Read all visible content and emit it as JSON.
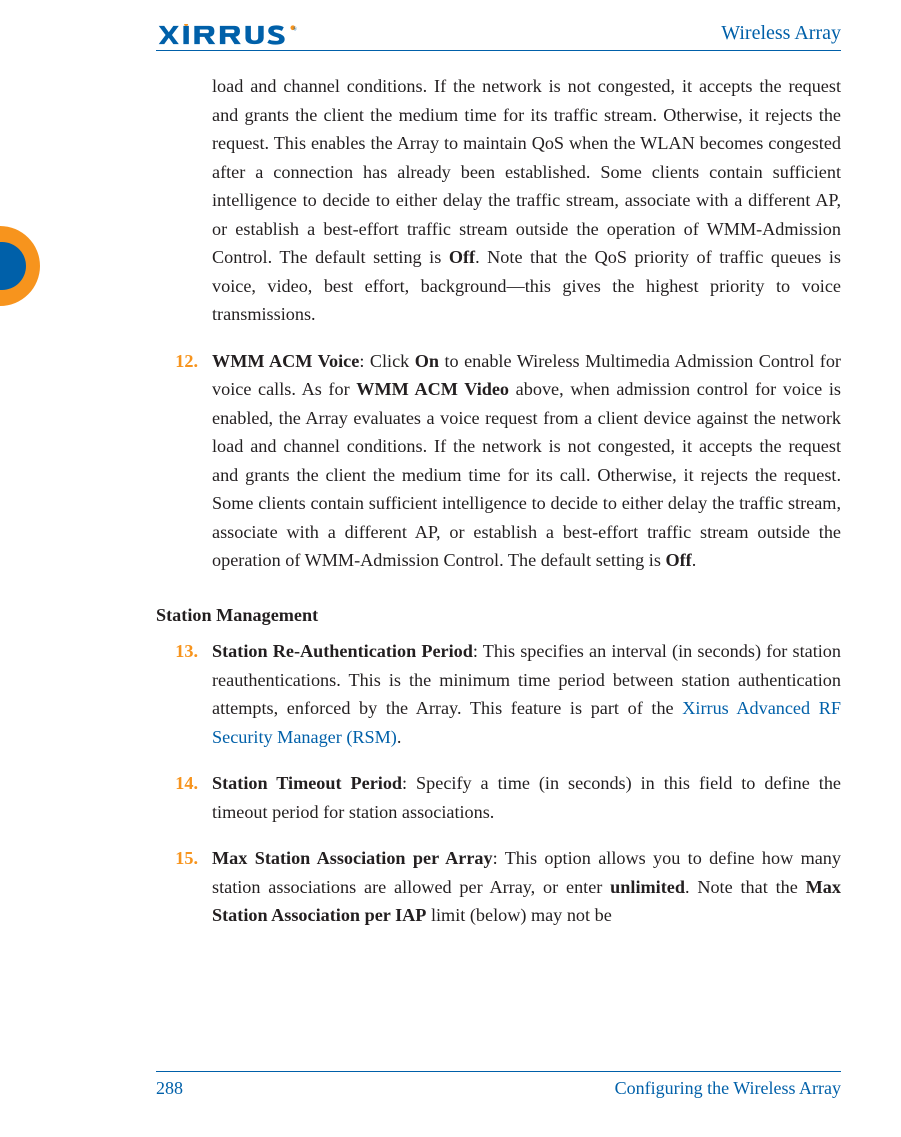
{
  "header": {
    "doc_title": "Wireless Array",
    "vendor": "XIRRUS"
  },
  "body": {
    "cont_para_pre": "load and channel conditions. If the network is not congested, it accepts the request and grants the client the medium time for its traffic stream. Otherwise, it rejects the request. This enables the Array to maintain QoS when the WLAN becomes congested after a connection has already been established. Some clients contain sufficient intelligence to decide to either delay the traffic stream, associate with a different AP, or establish a best-effort traffic stream outside the operation of WMM-Admission Control. The default setting is ",
    "cont_para_off": "Off",
    "cont_para_post": ". Note that the QoS priority of traffic queues is voice, video, best effort, background—this gives the highest priority to voice transmissions.",
    "item12": {
      "num": "12.",
      "title": "WMM ACM Voice",
      "seg_a": ": Click ",
      "on": "On",
      "seg_b": " to enable Wireless Multimedia Admission Control for voice calls. As for ",
      "wmm_video": "WMM ACM Video",
      "seg_c": " above, when admission control for voice is enabled, the Array evaluates a voice request from a client device against the network load and channel conditions. If the network is not congested, it accepts the request and grants the client the medium time for its call. Otherwise, it rejects the request. Some clients contain sufficient intelligence to decide to either delay the traffic stream, associate with a different AP, or establish a best-effort traffic stream outside the operation of WMM-Admission Control. The default setting is ",
      "off": "Off",
      "seg_d": "."
    },
    "section_head": "Station Management",
    "item13": {
      "num": "13.",
      "title": "Station Re-Authentication Period",
      "seg_a": ": This specifies an interval (in seconds) for station reauthentications. This is the minimum time period between station authentication attempts, enforced by the Array. This feature is part of the ",
      "link": "Xirrus Advanced RF Security Manager (RSM)",
      "seg_b": "."
    },
    "item14": {
      "num": "14.",
      "title": "Station Timeout Period",
      "seg_a": ": Specify a time (in seconds) in this field to define the timeout period for station associations."
    },
    "item15": {
      "num": "15.",
      "title": "Max Station Association per Array",
      "seg_a": ": This option allows you to define how many station associations are allowed per Array, or enter ",
      "unlimited": "unlimited",
      "seg_b": ". Note that the ",
      "msapi": "Max Station Association per IAP",
      "seg_c": " limit (below) may not be"
    }
  },
  "footer": {
    "page_number": "288",
    "chapter": "Configuring the Wireless Array"
  }
}
